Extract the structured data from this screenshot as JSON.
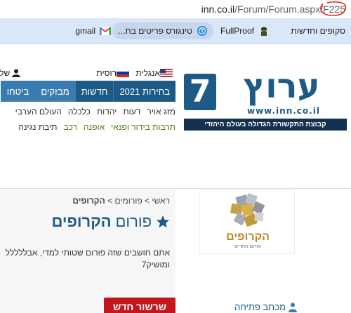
{
  "browser": {
    "url_host": "inn.co.il",
    "url_path": "/Forum/Forum.aspx/F225",
    "bookmarks": [
      {
        "label": "סקופים וחדשות",
        "icon": ""
      },
      {
        "label": "FullProof",
        "icon": "fullproof-icon"
      },
      {
        "label": "טינגורס פריטים בת...",
        "icon": "t-circle-icon"
      },
      {
        "label": "gmail",
        "icon": "gmail-icon"
      }
    ]
  },
  "header": {
    "logo_word": "ערוץ",
    "logo_number": "7",
    "logo_url": "www.inn.co.il",
    "logo_tagline": "קבוצת התקשורת הגדולה בעולם היהודי",
    "lang_english": "אנגלית",
    "lang_russian": "רוסית",
    "user_label": "שלו",
    "nav": [
      "בחירות 2021",
      "חדשות",
      "מבזקים",
      "ביטחו"
    ],
    "subnav1": [
      "מזג אויר",
      "דעות",
      "יהדות",
      "כלכלה",
      "העולם הערבי"
    ],
    "subnav2": [
      "תרבות בידור ופנאי",
      "אופנה",
      "רכב",
      "תיבת נגינה"
    ]
  },
  "forum": {
    "breadcrumb_home": "ראשי",
    "breadcrumb_sep": ">",
    "breadcrumb_forums": "פורומים",
    "breadcrumb_current": "הקרופים",
    "title_prefix": "פורום",
    "title_name": "הקרופים",
    "description": "אתם חושבים שזה פורום שטותי למדי, אבללללל ומושיק7",
    "new_thread_label": "שרשור חדש",
    "logo_text": "הקרופים",
    "logo_subtext": "פורום אתרים",
    "side_link": "מכתב פתיחה"
  },
  "colors": {
    "brand": "#1d5a85",
    "brand_dark": "#14314f",
    "nav_alt": "#3a7cb0",
    "button_red": "#c4171d",
    "link_green": "#4f7f1e",
    "annotation_red": "#e0241b"
  }
}
